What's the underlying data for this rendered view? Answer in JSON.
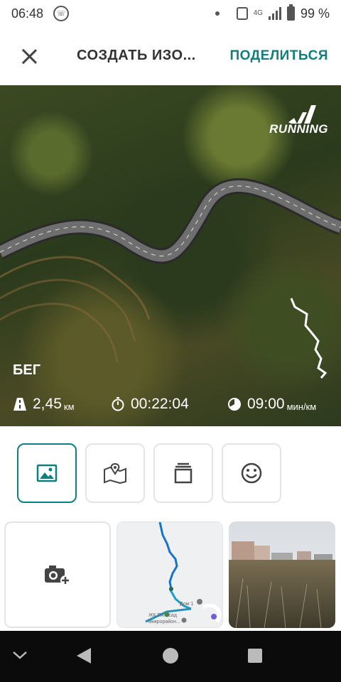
{
  "status": {
    "time": "06:48",
    "network": "4G",
    "battery": "99 %"
  },
  "appbar": {
    "title": "СОЗДАТЬ ИЗО...",
    "share": "ПОДЕЛИТЬСЯ"
  },
  "photo": {
    "brand_text": "RUNNING",
    "sport": "БЕГ",
    "distance": {
      "value": "2,45",
      "unit": "км"
    },
    "duration": {
      "value": "00:22:04"
    },
    "pace": {
      "value": "09:00",
      "unit": "мин/км"
    }
  },
  "toolbar": {
    "buttons": [
      {
        "icon": "image-icon",
        "active": true
      },
      {
        "icon": "map-icon",
        "active": false
      },
      {
        "icon": "layers-icon",
        "active": false
      },
      {
        "icon": "smiley-icon",
        "active": false
      }
    ]
  },
  "gallery": {
    "add_icon": "add-photo-icon",
    "map_labels": {
      "label1": "Дом 1",
      "label2": "ЖК Пятисад",
      "label3": "микрорайон..."
    }
  },
  "colors": {
    "accent": "#0e7f7d",
    "navbar": "#0b0b0b"
  }
}
